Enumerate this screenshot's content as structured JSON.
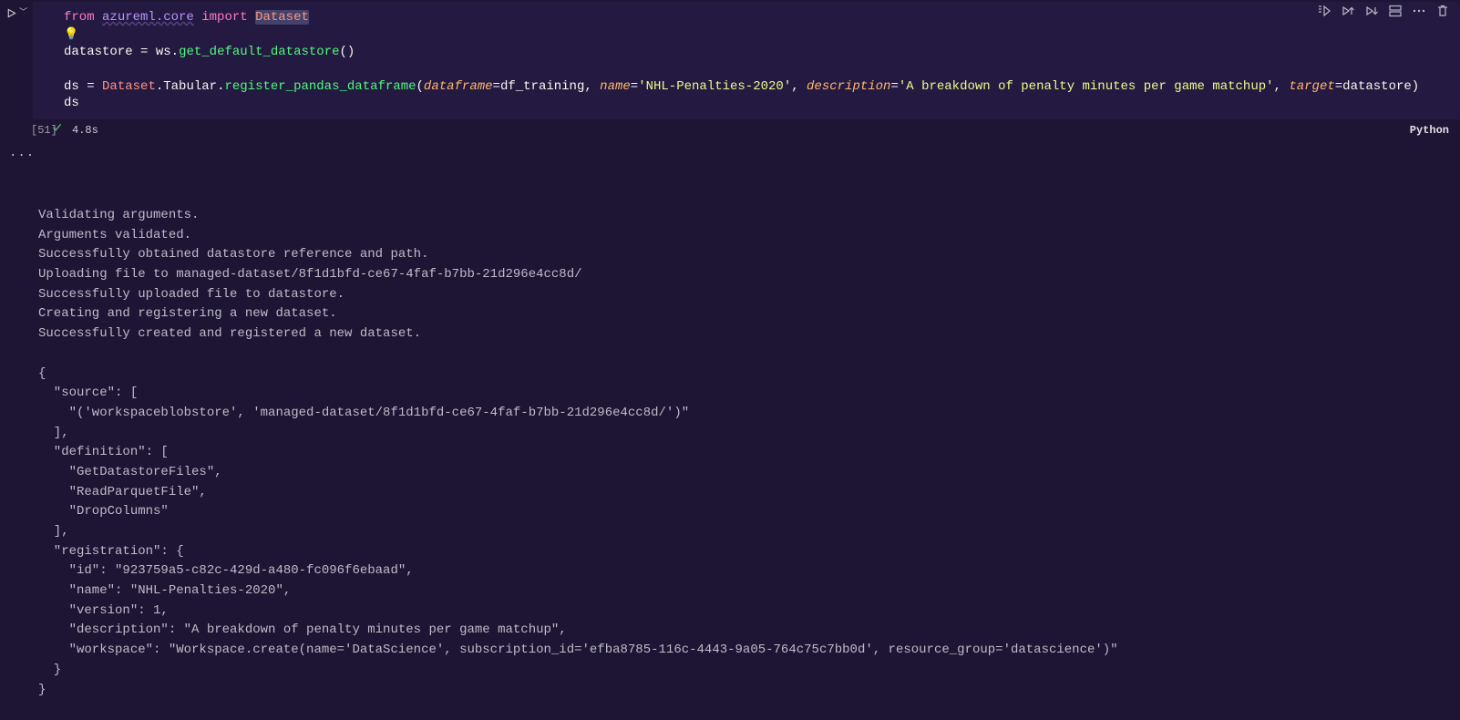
{
  "toolbar": {
    "run_by_line": "run-by-line",
    "execute_above": "execute-above",
    "execute_below": "execute-below",
    "split": "split-cell",
    "more": "more-actions",
    "delete": "delete-cell"
  },
  "gutter": {
    "run": "▷"
  },
  "code": {
    "kw_from": "from",
    "module": "azureml.core",
    "kw_import": "import",
    "class_dataset": "Dataset",
    "lightbulb": "💡",
    "line_datastore": {
      "var": "datastore",
      "eq": " = ",
      "obj": "ws",
      "dot": ".",
      "fn": "get_default_datastore",
      "call": "()"
    },
    "line_ds": {
      "var": "ds",
      "eq": " = ",
      "cls": "Dataset",
      "dot1": ".",
      "tab": "Tabular",
      "dot2": ".",
      "fn": "register_pandas_dataframe",
      "open": "(",
      "p1": "dataframe",
      "a1": "=df_training, ",
      "p2": "name",
      "a2": "=",
      "s2": "'NHL-Penalties-2020'",
      "c2": ", ",
      "p3": "description",
      "a3": "=",
      "s3": "'A breakdown of penalty minutes per game matchup'",
      "c3": ", ",
      "p4": "target",
      "a4": "=datastore",
      "close": ")"
    },
    "line_last": "ds"
  },
  "status": {
    "exec_count": "[51]",
    "time": "4.8s",
    "language": "Python"
  },
  "output_lines": [
    "Validating arguments.",
    "Arguments validated.",
    "Successfully obtained datastore reference and path.",
    "Uploading file to managed-dataset/8f1d1bfd-ce67-4faf-b7bb-21d296e4cc8d/",
    "Successfully uploaded file to datastore.",
    "Creating and registering a new dataset.",
    "Successfully created and registered a new dataset.",
    "",
    "{",
    "  \"source\": [",
    "    \"('workspaceblobstore', 'managed-dataset/8f1d1bfd-ce67-4faf-b7bb-21d296e4cc8d/')\"",
    "  ],",
    "  \"definition\": [",
    "    \"GetDatastoreFiles\",",
    "    \"ReadParquetFile\",",
    "    \"DropColumns\"",
    "  ],",
    "  \"registration\": {",
    "    \"id\": \"923759a5-c82c-429d-a480-fc096f6ebaad\",",
    "    \"name\": \"NHL-Penalties-2020\",",
    "    \"version\": 1,",
    "    \"description\": \"A breakdown of penalty minutes per game matchup\",",
    "    \"workspace\": \"Workspace.create(name='DataScience', subscription_id='efba8785-116c-4443-9a05-764c75c7bb0d', resource_group='datascience')\"",
    "  }",
    "}"
  ]
}
